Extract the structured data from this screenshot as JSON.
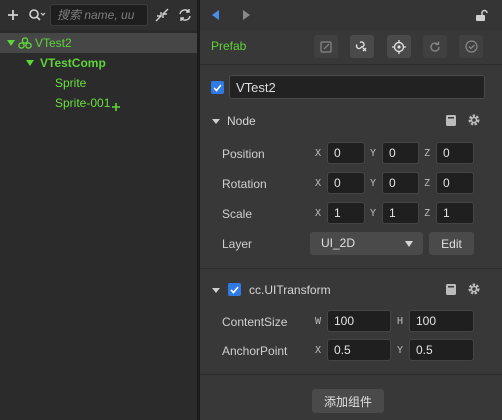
{
  "hierarchy": {
    "search_placeholder": "搜索 name, uu",
    "nodes": [
      {
        "label": "VTest2"
      },
      {
        "label": "VTestComp"
      },
      {
        "label": "Sprite"
      },
      {
        "label": "Sprite-001"
      }
    ]
  },
  "inspector": {
    "prefab_label": "Prefab",
    "node_name": "VTest2",
    "node_section": {
      "title": "Node",
      "position": {
        "label": "Position",
        "x": "0",
        "y": "0",
        "z": "0"
      },
      "rotation": {
        "label": "Rotation",
        "x": "0",
        "y": "0",
        "z": "0"
      },
      "scale": {
        "label": "Scale",
        "x": "1",
        "y": "1",
        "z": "1"
      },
      "layer": {
        "label": "Layer",
        "value": "UI_2D",
        "edit_label": "Edit"
      }
    },
    "uitransform_section": {
      "title": "cc.UITransform",
      "content_size": {
        "label": "ContentSize",
        "w": "100",
        "h": "100"
      },
      "anchor_point": {
        "label": "AnchorPoint",
        "x": "0.5",
        "y": "0.5"
      }
    },
    "add_component_label": "添加组件",
    "axis_labels": {
      "x": "X",
      "y": "Y",
      "z": "Z",
      "w": "W",
      "h": "H"
    }
  },
  "colors": {
    "accent": "#5fd33a",
    "checkbox": "#2f7ae5"
  }
}
